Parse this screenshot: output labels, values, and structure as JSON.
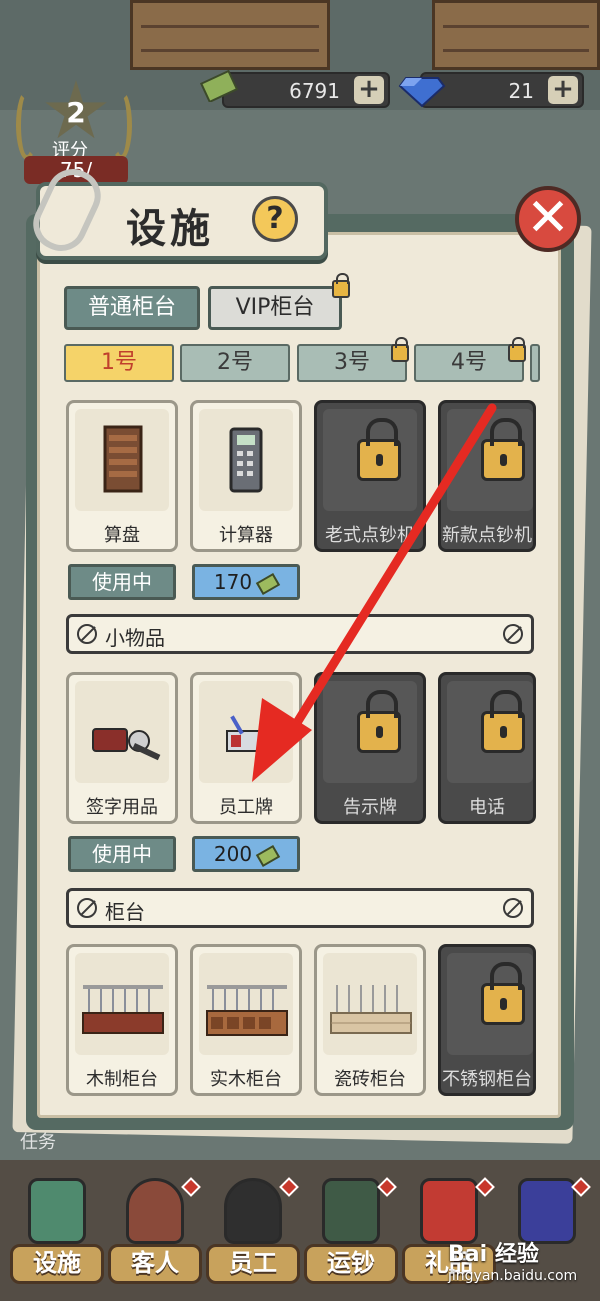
{
  "currency": {
    "money": "6791",
    "gems": "21"
  },
  "rating": {
    "level": "2",
    "label": "评分",
    "score": "75/"
  },
  "dialog": {
    "title": "设施",
    "help": "?",
    "close": "✕"
  },
  "category_tabs": [
    {
      "label": "普通柜台"
    },
    {
      "label": "VIP柜台"
    }
  ],
  "counter_tabs": [
    {
      "label": "1号"
    },
    {
      "label": "2号"
    },
    {
      "label": "3号"
    },
    {
      "label": "4号"
    }
  ],
  "row1": {
    "items": [
      {
        "label": "算盘"
      },
      {
        "label": "计算器"
      },
      {
        "label": "老式点钞机"
      },
      {
        "label": "新款点钞机"
      }
    ],
    "status": "使用中",
    "price": "170"
  },
  "section_small": {
    "label": "小物品"
  },
  "row2": {
    "items": [
      {
        "label": "签字用品"
      },
      {
        "label": "员工牌"
      },
      {
        "label": "告示牌"
      },
      {
        "label": "电话"
      }
    ],
    "status": "使用中",
    "price": "200"
  },
  "section_counter": {
    "label": "柜台"
  },
  "row3": {
    "items": [
      {
        "label": "木制柜台"
      },
      {
        "label": "实木柜台"
      },
      {
        "label": "瓷砖柜台"
      },
      {
        "label": "不锈钢柜台"
      }
    ]
  },
  "bottom_nav": [
    {
      "label": "设施"
    },
    {
      "label": "客人"
    },
    {
      "label": "员工"
    },
    {
      "label": "运钞"
    },
    {
      "label": "礼品"
    }
  ],
  "partial_text": {
    "task": "任务"
  },
  "watermark": {
    "brand": "Bai 经验",
    "url": "jingyan.baidu.com"
  }
}
